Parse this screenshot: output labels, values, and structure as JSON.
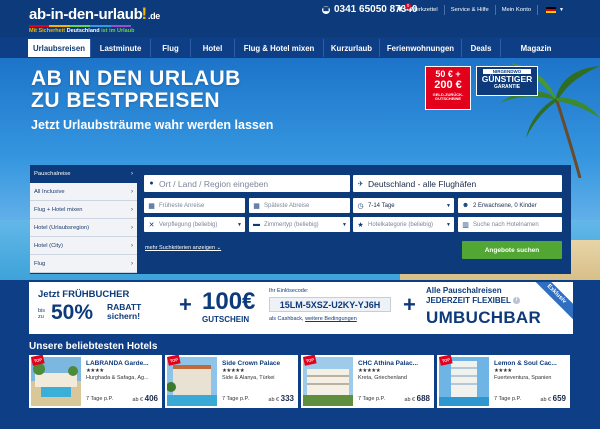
{
  "header": {
    "logo_text": "ab-in-den-urlaub",
    "logo_excl": "!",
    "logo_tld": ".de",
    "logo_tagline_1": "Mit Sicherheit",
    "logo_tagline_2": "Deutschland",
    "logo_tagline_3": "ist im Urlaub",
    "phone": "0341 65050 87340",
    "wishlist_label": "Merkzettel",
    "wishlist_count": "0",
    "service_label": "Service & Hilfe",
    "account_label": "Mein Konto",
    "colors": {
      "bar": "#0d3a7a",
      "accent_yellow": "#f4b400",
      "accent_red": "#e2001a"
    }
  },
  "nav": {
    "items": [
      {
        "label": "Urlaubsreisen"
      },
      {
        "label": "Lastminute"
      },
      {
        "label": "Flug"
      },
      {
        "label": "Hotel"
      },
      {
        "label": "Flug & Hotel mixen"
      },
      {
        "label": "Kurzurlaub"
      },
      {
        "label": "Ferienwohnungen"
      },
      {
        "label": "Deals"
      },
      {
        "label": "Magazin"
      }
    ],
    "active_index": 0
  },
  "hero": {
    "title_line1": "AB IN DEN URLAUB",
    "title_line2": "ZU BESTPREISEN",
    "subtitle": "Jetzt Urlaubsträume wahr werden lassen",
    "voucher_top": "50 € +",
    "voucher_main": "200 €",
    "voucher_sub": "GELD-ZURÜCK-GUTSCHEINE",
    "guarantee_top": "NIRGENDWO",
    "guarantee_main": "GÜNSTIGER",
    "guarantee_sub": "GARANTIE"
  },
  "search": {
    "tabs": [
      {
        "label": "Pauschalreise"
      },
      {
        "label": "All Inclusive"
      },
      {
        "label": "Flug + Hotel mixen"
      },
      {
        "label": "Hotel (Urlaubsregion)"
      },
      {
        "label": "Hotel (City)"
      },
      {
        "label": "Flug"
      }
    ],
    "destination_placeholder": "Ort / Land / Region eingeben",
    "airport_value": "Deutschland - alle Flughäfen",
    "earliest_placeholder": "Früheste Anreise",
    "latest_placeholder": "Späteste Abreise",
    "duration_value": "7-14 Tage",
    "travellers_value": "2 Erwachsene, 0 Kinder",
    "board_value": "Verpflegung (beliebig)",
    "room_value": "Zimmertyp (beliebig)",
    "category_value": "Hotelkategorie (beliebig)",
    "hotel_name_placeholder": "Suche nach Hotelnamen",
    "more_criteria": "mehr Suchkriterien anzeigen",
    "search_button": "Angebote suchen"
  },
  "promo": {
    "early_title": "Jetzt FRÜHBUCHER",
    "early_bis": "bis zu",
    "early_percent": "50%",
    "early_rabatt": "RABATT sichern!",
    "voucher_amount": "100€",
    "voucher_label": "GUTSCHEIN",
    "code_label": "Ihr Einlösecode:",
    "code": "15LM-5XSZ-U2KY-YJ6H",
    "cash_text": "als Cashback,",
    "cash_link": "weitere Bedingungen",
    "flex_line1": "Alle Pauschalreisen",
    "flex_line2": "JEDERZEIT FLEXIBEL",
    "flex_main": "UMBUCHBAR",
    "exklusiv": "Exklusiv"
  },
  "hotels": {
    "title": "Unsere beliebtesten Hotels",
    "items": [
      {
        "badge": "TOP",
        "name": "LABRANDA Garde...",
        "stars": "★★★★",
        "location": "Hurghada & Safaga, Äg...",
        "duration": "7 Tage p.P.",
        "price_prefix": "ab €",
        "price": "406"
      },
      {
        "badge": "TOP",
        "name": "Side Crown Palace",
        "stars": "★★★★★",
        "location": "Side & Alanya, Türkei",
        "duration": "7 Tage p.P.",
        "price_prefix": "ab €",
        "price": "333"
      },
      {
        "badge": "TOP",
        "name": "CHC Athina Palac...",
        "stars": "★★★★★",
        "location": "Kreta, Griechenland",
        "duration": "7 Tage p.P.",
        "price_prefix": "ab €",
        "price": "688"
      },
      {
        "badge": "TOP",
        "name": "Lemon & Soul Cac...",
        "stars": "★★★★",
        "location": "Fuerteventura, Spanien",
        "duration": "7 Tage p.P.",
        "price_prefix": "ab €",
        "price": "659"
      }
    ]
  }
}
